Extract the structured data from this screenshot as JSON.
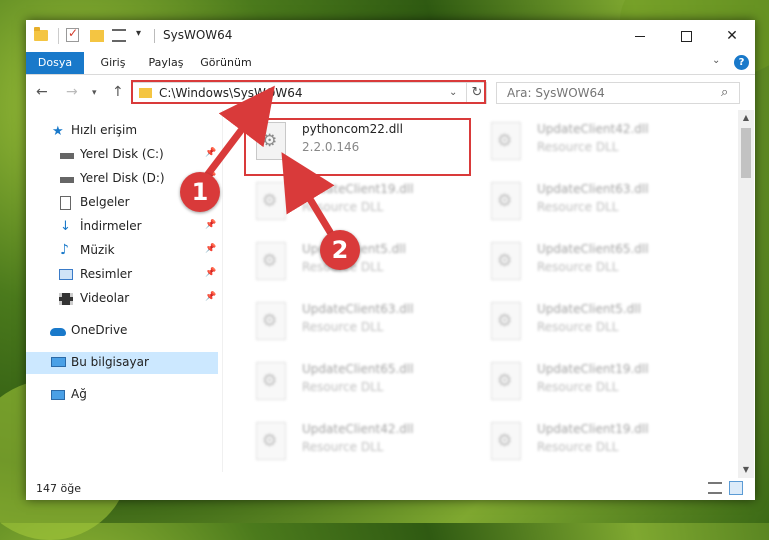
{
  "window": {
    "title": "SysWOW64",
    "controls": {
      "minimize": "",
      "maximize": "",
      "close": "✕"
    }
  },
  "ribbon": {
    "tabs": [
      "Dosya",
      "Giriş",
      "Paylaş",
      "Görünüm"
    ],
    "help": "?"
  },
  "navigation": {
    "address": "C:\\Windows\\SysWOW64",
    "search_placeholder": "Ara: SysWOW64"
  },
  "sidebar": {
    "items": [
      {
        "label": "Hızlı erişim",
        "icon": "star-icon"
      },
      {
        "label": "Yerel Disk (C:)",
        "icon": "drive-icon",
        "pinned": true
      },
      {
        "label": "Yerel Disk (D:)",
        "icon": "drive-icon",
        "pinned": true
      },
      {
        "label": "Belgeler",
        "icon": "document-icon",
        "pinned": true
      },
      {
        "label": "İndirmeler",
        "icon": "download-icon",
        "pinned": true
      },
      {
        "label": "Müzik",
        "icon": "music-icon",
        "pinned": true
      },
      {
        "label": "Resimler",
        "icon": "picture-icon",
        "pinned": true
      },
      {
        "label": "Videolar",
        "icon": "video-icon",
        "pinned": true
      },
      {
        "label": "OneDrive",
        "icon": "cloud-icon"
      },
      {
        "label": "Bu bilgisayar",
        "icon": "computer-icon",
        "selected": true
      },
      {
        "label": "Ağ",
        "icon": "network-icon"
      }
    ]
  },
  "files": [
    {
      "name": "pythoncom22.dll",
      "sub": "2.2.0.146",
      "highlight": true
    },
    {
      "name": "UpdateClient42.dll",
      "sub": "Resource DLL"
    },
    {
      "name": "UpdateClient19.dll",
      "sub": "Resource DLL"
    },
    {
      "name": "UpdateClient63.dll",
      "sub": "Resource DLL"
    },
    {
      "name": "UpdateClient5.dll",
      "sub": "Resource DLL"
    },
    {
      "name": "UpdateClient65.dll",
      "sub": "Resource DLL"
    },
    {
      "name": "UpdateClient63.dll",
      "sub": "Resource DLL"
    },
    {
      "name": "UpdateClient5.dll",
      "sub": "Resource DLL"
    },
    {
      "name": "UpdateClient65.dll",
      "sub": "Resource DLL"
    },
    {
      "name": "UpdateClient19.dll",
      "sub": "Resource DLL"
    },
    {
      "name": "UpdateClient42.dll",
      "sub": "Resource DLL"
    },
    {
      "name": "UpdateClient19.dll",
      "sub": "Resource DLL"
    }
  ],
  "status": {
    "count": "147 öğe"
  },
  "annotations": {
    "marker1": "1",
    "marker2": "2",
    "color": "#d93a3a"
  },
  "colors": {
    "accent": "#1979ca",
    "selection": "#cce8ff"
  }
}
